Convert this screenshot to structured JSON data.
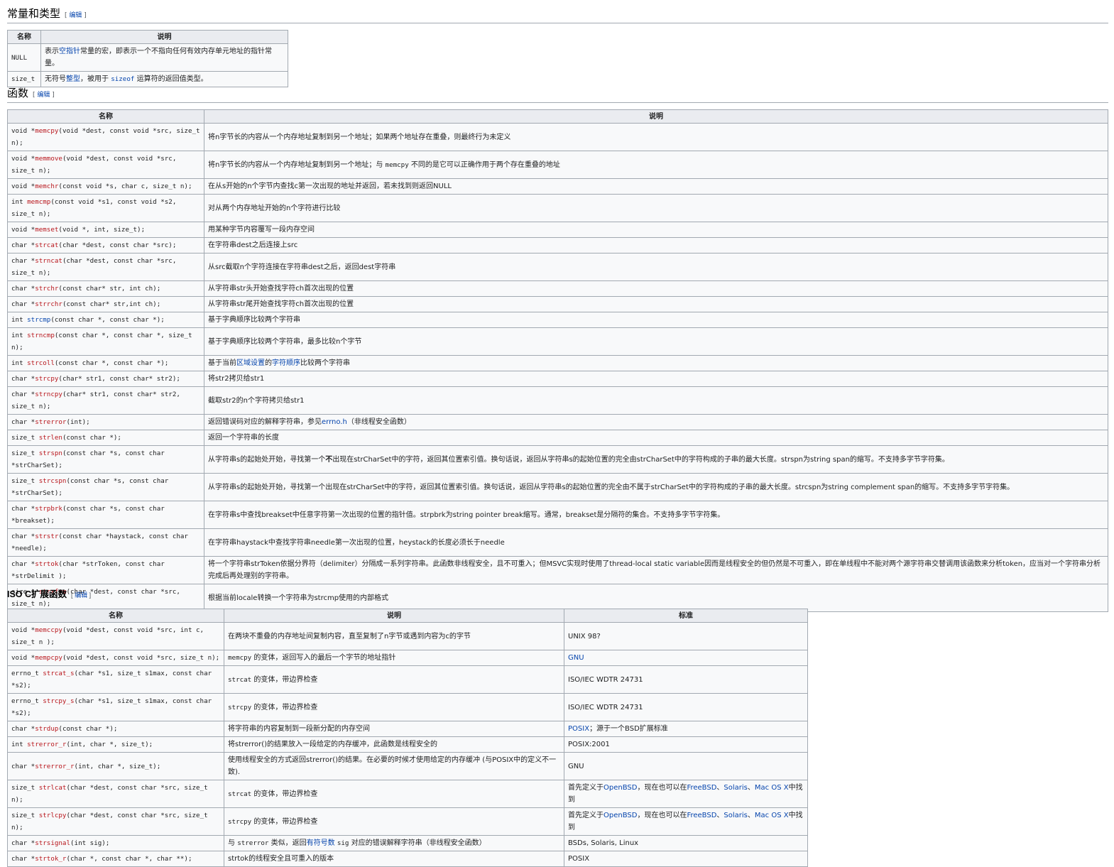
{
  "edit_label": "编辑",
  "constants": {
    "heading": "常量和类型",
    "headers": [
      "名称",
      "说明"
    ],
    "rows": [
      {
        "name": "NULL",
        "desc_parts": [
          {
            "t": "表示"
          },
          {
            "t": "空指针",
            "link": true
          },
          {
            "t": "常量的宏，即表示一个不指向任何有效内存单元地址的指针常量。"
          }
        ]
      },
      {
        "name": "size_t",
        "desc_parts": [
          {
            "t": "无符号"
          },
          {
            "t": "整型",
            "link": true
          },
          {
            "t": "，被用于 "
          },
          {
            "t": "sizeof",
            "link": true,
            "mono": true
          },
          {
            "t": " 运算符的返回值类型。"
          }
        ]
      }
    ]
  },
  "functions": {
    "heading": "函数",
    "headers": [
      "名称",
      "说明"
    ],
    "rows": [
      {
        "pre": "void *",
        "fn": "memcpy",
        "fnlink": false,
        "post": "(void *dest, const void *src, size_t n);",
        "desc_parts": [
          {
            "t": "将n字节长的内容从一个内存地址复制到另一个地址；如果两个地址存在重叠，则最终行为未定义"
          }
        ]
      },
      {
        "pre": "void *",
        "fn": "memmove",
        "fnlink": false,
        "post": "(void *dest, const void *src, size_t n);",
        "desc_parts": [
          {
            "t": "将n字节长的内容从一个内存地址复制到另一个地址；与 "
          },
          {
            "t": "memcpy",
            "mono": true
          },
          {
            "t": " 不同的是它可以正确作用于两个存在重叠的地址"
          }
        ]
      },
      {
        "pre": "void *",
        "fn": "memchr",
        "fnlink": false,
        "post": "(const void *s, char c, size_t n);",
        "desc_parts": [
          {
            "t": "在从s开始的n个字节内查找c第一次出现的地址并返回，若未找到则返回NULL"
          }
        ]
      },
      {
        "pre": "int ",
        "fn": "memcmp",
        "fnlink": false,
        "post": "(const void *s1, const void *s2, size_t n);",
        "desc_parts": [
          {
            "t": "对从两个内存地址开始的n个字符进行比较"
          }
        ]
      },
      {
        "pre": "void *",
        "fn": "memset",
        "fnlink": false,
        "post": "(void *, int, size_t);",
        "desc_parts": [
          {
            "t": "用某种字节内容覆写一段内存空间"
          }
        ]
      },
      {
        "pre": "char *",
        "fn": "strcat",
        "fnlink": false,
        "post": "(char *dest, const char *src);",
        "desc_parts": [
          {
            "t": "在字符串dest之后连接上src"
          }
        ]
      },
      {
        "pre": "char *",
        "fn": "strncat",
        "fnlink": false,
        "post": "(char *dest, const char *src, size_t n);",
        "desc_parts": [
          {
            "t": "从src截取n个字符连接在字符串dest之后，返回dest字符串"
          }
        ]
      },
      {
        "pre": "char *",
        "fn": "strchr",
        "fnlink": false,
        "post": "(const char* str, int ch);",
        "desc_parts": [
          {
            "t": "从字符串str头开始查找字符ch首次出现的位置"
          }
        ]
      },
      {
        "pre": "char *",
        "fn": "strrchr",
        "fnlink": false,
        "post": "(const char* str,int ch);",
        "desc_parts": [
          {
            "t": "从字符串str尾开始查找字符ch首次出现的位置"
          }
        ]
      },
      {
        "pre": "int ",
        "fn": "strcmp",
        "fnlink": true,
        "post": "(const char *, const char *);",
        "desc_parts": [
          {
            "t": "基于字典顺序比较两个字符串"
          }
        ]
      },
      {
        "pre": "int ",
        "fn": "strncmp",
        "fnlink": false,
        "post": "(const char *, const char *, size_t n);",
        "desc_parts": [
          {
            "t": "基于字典顺序比较两个字符串，最多比较n个字节"
          }
        ]
      },
      {
        "pre": "int ",
        "fn": "strcoll",
        "fnlink": false,
        "post": "(const char *, const char *);",
        "desc_parts": [
          {
            "t": "基于当前"
          },
          {
            "t": "区域设置",
            "link": true
          },
          {
            "t": "的"
          },
          {
            "t": "字符顺序",
            "link": true
          },
          {
            "t": "比较两个字符串"
          }
        ]
      },
      {
        "pre": "char *",
        "fn": "strcpy",
        "fnlink": false,
        "post": "(char* str1, const char* str2);",
        "desc_parts": [
          {
            "t": "将str2拷贝给str1"
          }
        ]
      },
      {
        "pre": "char *",
        "fn": "strncpy",
        "fnlink": false,
        "post": "(char* str1, const char* str2, size_t n);",
        "desc_parts": [
          {
            "t": "截取str2的n个字符拷贝给str1"
          }
        ]
      },
      {
        "pre": "char *",
        "fn": "strerror",
        "fnlink": false,
        "post": "(int);",
        "desc_parts": [
          {
            "t": "返回错误码对应的解释字符串，参见"
          },
          {
            "t": "errno.h",
            "link": true
          },
          {
            "t": "（非线程安全函数）"
          }
        ]
      },
      {
        "pre": "size_t ",
        "fn": "strlen",
        "fnlink": false,
        "post": "(const char *);",
        "desc_parts": [
          {
            "t": "返回一个字符串的长度"
          }
        ]
      },
      {
        "pre": "size_t ",
        "fn": "strspn",
        "fnlink": false,
        "post": "(const char *s, const char *strCharSet);",
        "desc_parts": [
          {
            "t": "从字符串s的起始处开始，寻找第一个"
          },
          {
            "t": "不",
            "bold": true
          },
          {
            "t": "出现在strCharSet中的字符，返回其位置索引值。换句话说，返回从字符串s的起始位置的完全由strCharSet中的字符构成的子串的最大长度。strspn为string span的缩写。不支持多字节字符集。"
          }
        ]
      },
      {
        "pre": "size_t ",
        "fn": "strcspn",
        "fnlink": false,
        "post": "(const char *s, const char *strCharSet);",
        "desc_parts": [
          {
            "t": "从字符串s的起始处开始，寻找第一个出现在strCharSet中的字符，返回其位置索引值。换句话说，返回从字符串s的起始位置的完全由不属于strCharSet中的字符构成的子串的最大长度。strcspn为string complement span的缩写。不支持多字节字符集。"
          }
        ]
      },
      {
        "pre": "char *",
        "fn": "strpbrk",
        "fnlink": false,
        "post": "(const char *s, const char *breakset);",
        "desc_parts": [
          {
            "t": "在字符串s中查找breakset中任意字符第一次出现的位置的指针值。strpbrk为string pointer break缩写。通常，breakset是分隔符的集合。不支持多字节字符集。"
          }
        ]
      },
      {
        "pre": "char *",
        "fn": "strstr",
        "fnlink": false,
        "post": "(const char *haystack, const char *needle);",
        "desc_parts": [
          {
            "t": "在字符串haystack中查找字符串needle第一次出现的位置，heystack的长度必须长于needle"
          }
        ]
      },
      {
        "pre": "char *",
        "fn": "strtok",
        "fnlink": false,
        "post": "(char *strToken, const char *strDelimit );",
        "desc_parts": [
          {
            "t": "将一个字符串strToken依据分界符（delimiter）分隔成一系列字符串。此函数非线程安全，且不可重入；但MSVC实现时使用了thread-local static variable因而是线程安全的但仍然是不可重入，即在单线程中不能对两个源字符串交替调用该函数来分析token，应当对一个字符串分析完成后再处理别的字符串。"
          }
        ]
      },
      {
        "pre": "size_t ",
        "fn": "strxfrm",
        "fnlink": false,
        "post": "(char *dest, const char *src, size_t n);",
        "desc_parts": [
          {
            "t": "根据当前locale转换一个字符串为strcmp使用的内部格式"
          }
        ]
      }
    ]
  },
  "extensions": {
    "heading": "ISO C扩展函数",
    "headers": [
      "名称",
      "说明",
      "标准"
    ],
    "rows": [
      {
        "pre": "void *",
        "fn": "memccpy",
        "post": "(void *dest, const void *src, int c, size_t n );",
        "desc_parts": [
          {
            "t": "在两块不重叠的内存地址间复制内容，直至复制了n字节或遇到内容为c的字节"
          }
        ],
        "std_parts": [
          {
            "t": "UNIX 98?"
          }
        ]
      },
      {
        "pre": "void *",
        "fn": "mempcpy",
        "post": "(void *dest, const void *src, size_t n);",
        "desc_parts": [
          {
            "t": "memcpy",
            "mono": true
          },
          {
            "t": " 的变体，返回写入的最后一个字节的地址指针"
          }
        ],
        "std_parts": [
          {
            "t": "GNU",
            "link": true
          }
        ]
      },
      {
        "pre": "errno_t ",
        "fn": "strcat_s",
        "post": "(char *s1, size_t s1max, const char *s2);",
        "desc_parts": [
          {
            "t": "strcat",
            "mono": true
          },
          {
            "t": " 的变体，带边界检查"
          }
        ],
        "std_parts": [
          {
            "t": "ISO/IEC WDTR 24731"
          }
        ]
      },
      {
        "pre": "errno_t ",
        "fn": "strcpy_s",
        "post": "(char *s1, size_t s1max, const char *s2);",
        "desc_parts": [
          {
            "t": "strcpy",
            "mono": true
          },
          {
            "t": " 的变体，带边界检查"
          }
        ],
        "std_parts": [
          {
            "t": "ISO/IEC WDTR 24731"
          }
        ]
      },
      {
        "pre": "char *",
        "fn": "strdup",
        "post": "(const char *);",
        "desc_parts": [
          {
            "t": "将字符串的内容复制到一段新分配的内存空间"
          }
        ],
        "std_parts": [
          {
            "t": "POSIX",
            "link": true
          },
          {
            "t": "；源于一个BSD扩展标准"
          }
        ]
      },
      {
        "pre": "int ",
        "fn": "strerror_r",
        "post": "(int, char *, size_t);",
        "desc_parts": [
          {
            "t": "将strerror()的结果放入一段给定的内存缓冲，此函数是线程安全的"
          }
        ],
        "std_parts": [
          {
            "t": "POSIX:2001"
          }
        ]
      },
      {
        "pre": "char *",
        "fn": "strerror_r",
        "post": "(int, char *, size_t);",
        "desc_parts": [
          {
            "t": "使用线程安全的方式返回strerror()的结果。在必要的时候才使用给定的内存缓冲 (与POSIX中的定义不一致)."
          }
        ],
        "std_parts": [
          {
            "t": "GNU"
          }
        ]
      },
      {
        "pre": "size_t ",
        "fn": "strlcat",
        "post": "(char *dest, const char *src, size_t n);",
        "desc_parts": [
          {
            "t": "strcat",
            "mono": true
          },
          {
            "t": " 的变体，带边界检查"
          }
        ],
        "std_parts": [
          {
            "t": "首先定义于"
          },
          {
            "t": "OpenBSD",
            "link": true
          },
          {
            "t": "，现在也可以在"
          },
          {
            "t": "FreeBSD",
            "link": true
          },
          {
            "t": "、"
          },
          {
            "t": "Solaris",
            "link": true
          },
          {
            "t": "、"
          },
          {
            "t": "Mac OS X",
            "link": true
          },
          {
            "t": "中找到"
          }
        ]
      },
      {
        "pre": "size_t ",
        "fn": "strlcpy",
        "post": "(char *dest, const char *src, size_t n);",
        "desc_parts": [
          {
            "t": "strcpy",
            "mono": true
          },
          {
            "t": " 的变体，带边界检查"
          }
        ],
        "std_parts": [
          {
            "t": "首先定义于"
          },
          {
            "t": "OpenBSD",
            "link": true
          },
          {
            "t": "，现在也可以在"
          },
          {
            "t": "FreeBSD",
            "link": true
          },
          {
            "t": "、"
          },
          {
            "t": "Solaris",
            "link": true
          },
          {
            "t": "、"
          },
          {
            "t": "Mac OS X",
            "link": true
          },
          {
            "t": "中找到"
          }
        ]
      },
      {
        "pre": "char *",
        "fn": "strsignal",
        "post": "(int sig);",
        "desc_parts": [
          {
            "t": "与 "
          },
          {
            "t": "strerror",
            "mono": true
          },
          {
            "t": " 类似，返回"
          },
          {
            "t": "有符号数",
            "link": true
          },
          {
            "t": " "
          },
          {
            "t": "sig",
            "mono": true
          },
          {
            "t": " 对应的错误解释字符串（非线程安全函数）"
          }
        ],
        "std_parts": [
          {
            "t": "BSDs, Solaris, Linux"
          }
        ]
      },
      {
        "pre": "char *",
        "fn": "strtok_r",
        "post": "(char *, const char *, char **);",
        "desc_parts": [
          {
            "t": "strtok的线程安全且可重入的版本"
          }
        ],
        "std_parts": [
          {
            "t": "POSIX"
          }
        ]
      }
    ]
  }
}
